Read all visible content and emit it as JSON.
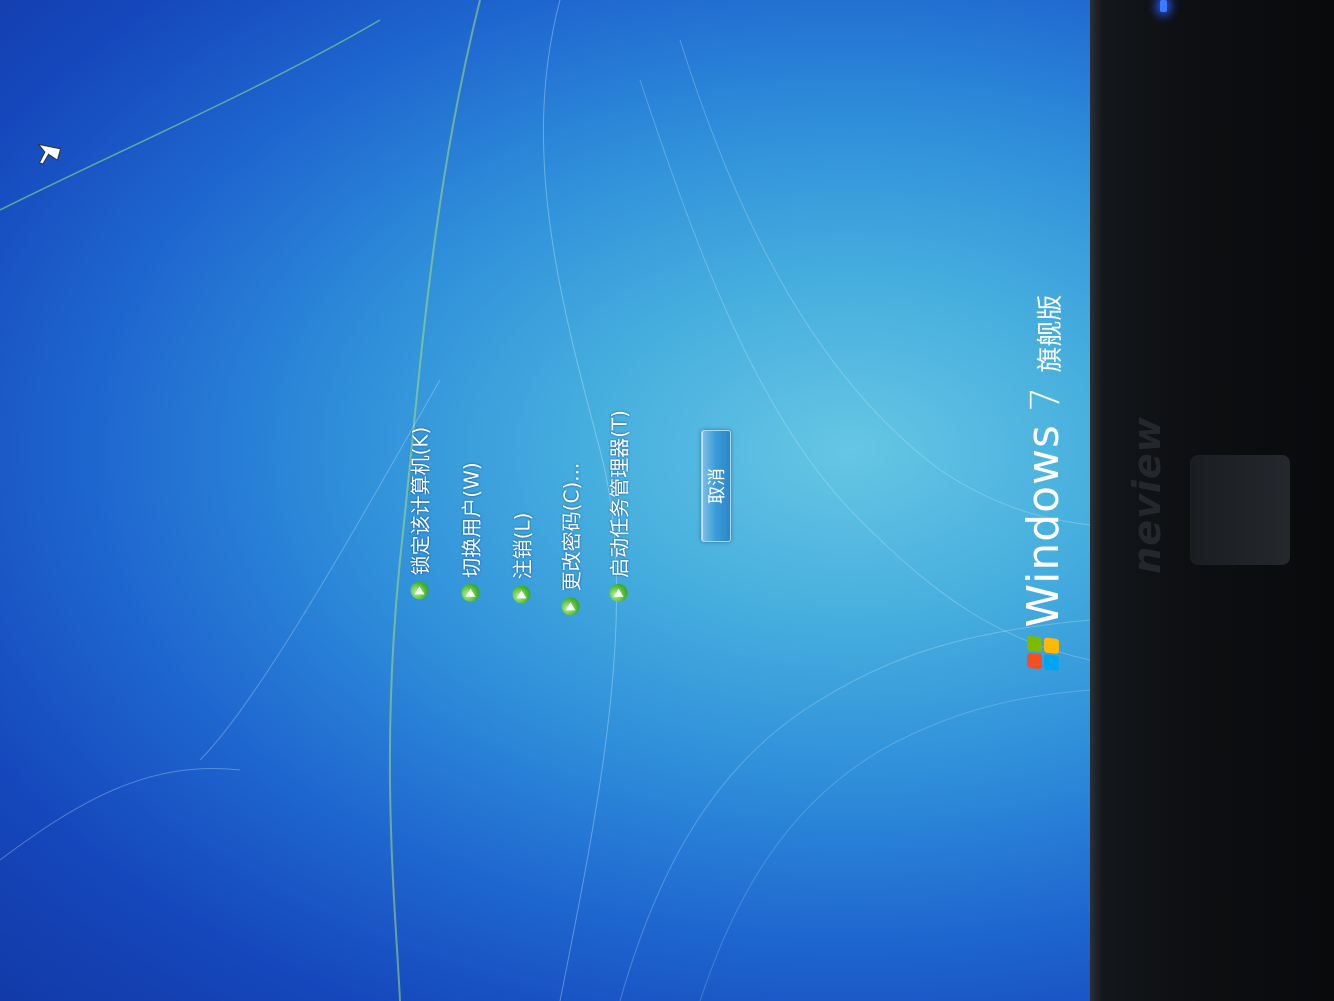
{
  "menu": {
    "items": [
      {
        "label": "锁定该计算机(K)",
        "icon": "green-arrow-icon"
      },
      {
        "label": "切换用户(W)",
        "icon": "green-arrow-icon"
      },
      {
        "label": "注销(L)",
        "icon": "green-arrow-icon"
      },
      {
        "label": "更改密码(C)...",
        "icon": "green-arrow-icon"
      },
      {
        "label": "启动任务管理器(T)",
        "icon": "green-arrow-icon"
      }
    ]
  },
  "cancel_button": {
    "label": "取消"
  },
  "branding": {
    "product": "Windows",
    "version": "7",
    "edition": "旗舰版",
    "logo_icon": "windows-flag-icon"
  },
  "monitor": {
    "brand": "neview",
    "power_led_color": "#3b7bff"
  },
  "colors": {
    "background_light": "#66c6e4",
    "background_dark": "#123aa8",
    "bezel": "#0d0f12",
    "arrow_green": "#43b52a"
  }
}
